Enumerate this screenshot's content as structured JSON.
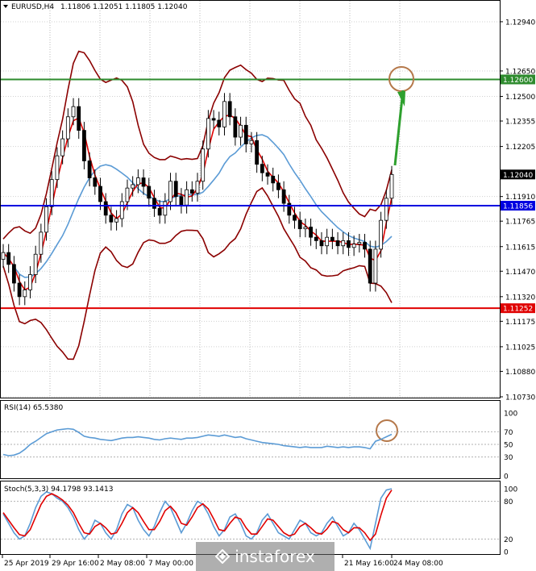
{
  "header": {
    "symbol": "EURUSD,H4",
    "ohlc": "1.11806 1.12051 1.11805 1.12040",
    "rsi_label": "RSI(14) 65.5380",
    "stoch_label": "Stoch(5,3,3) 94.1798 93.1413"
  },
  "levels": {
    "green": {
      "value": 1.126,
      "label": "1.12600",
      "color": "#2e8b2e"
    },
    "blue": {
      "value": 1.11856,
      "label": "1.11856",
      "color": "#0000e0"
    },
    "red": {
      "value": 1.11252,
      "label": "1.11252",
      "color": "#e00000"
    },
    "current": {
      "value": 1.1204,
      "label": "1.12040",
      "color": "#000000"
    }
  },
  "watermark": {
    "text": "instaforex"
  },
  "chart_data": [
    {
      "type": "candlestick",
      "title": "EURUSD,H4",
      "ylim": [
        1.1073,
        1.1303
      ],
      "y_ticks": [
        "1.12940",
        "1.12650",
        "1.12500",
        "1.12355",
        "1.12205",
        "1.11910",
        "1.11765",
        "1.11615",
        "1.11470",
        "1.11320",
        "1.11175",
        "1.11025",
        "1.10880",
        "1.10730"
      ],
      "x_ticks": [
        "25 Apr 2019",
        "29 Apr 16:00",
        "2 May 08:00",
        "7 May 00:00",
        "21 May 16:00",
        "24 May 08:00"
      ],
      "close": [
        1.1158,
        1.1151,
        1.114,
        1.1132,
        1.1136,
        1.1145,
        1.1157,
        1.117,
        1.1185,
        1.1201,
        1.1215,
        1.1225,
        1.1238,
        1.1244,
        1.123,
        1.1212,
        1.1202,
        1.1197,
        1.1188,
        1.118,
        1.1176,
        1.1178,
        1.1188,
        1.1196,
        1.1198,
        1.1202,
        1.1197,
        1.119,
        1.1184,
        1.118,
        1.1188,
        1.12,
        1.1191,
        1.1186,
        1.1195,
        1.1193,
        1.12,
        1.1219,
        1.1237,
        1.1236,
        1.1232,
        1.1247,
        1.1238,
        1.1226,
        1.1233,
        1.1222,
        1.1224,
        1.121,
        1.1205,
        1.1203,
        1.1199,
        1.1195,
        1.1187,
        1.118,
        1.1177,
        1.1172,
        1.1173,
        1.1167,
        1.1165,
        1.1162,
        1.1167,
        1.1165,
        1.1162,
        1.1165,
        1.1161,
        1.1163,
        1.1164,
        1.116,
        1.114,
        1.116,
        1.1177,
        1.119,
        1.1204
      ],
      "series": [
        {
          "name": "Bollinger upper",
          "color": "#8b0000"
        },
        {
          "name": "Bollinger lower",
          "color": "#8b0000"
        },
        {
          "name": "fast MA",
          "color": "#e00000"
        },
        {
          "name": "slow MA",
          "color": "#5b9bd5"
        }
      ]
    },
    {
      "type": "line",
      "title": "RSI(14) 65.5380",
      "ylim": [
        0,
        100
      ],
      "levels": [
        70,
        50,
        30
      ],
      "y_ticks": [
        "100",
        "70",
        "50",
        "30",
        "0"
      ],
      "series": [
        {
          "name": "RSI",
          "color": "#5b9bd5",
          "values": [
            34,
            32,
            33,
            36,
            42,
            50,
            55,
            61,
            67,
            70,
            73,
            74,
            75,
            74,
            69,
            63,
            61,
            60,
            58,
            57,
            56,
            58,
            60,
            61,
            61,
            62,
            61,
            60,
            58,
            57,
            59,
            60,
            59,
            58,
            60,
            60,
            61,
            63,
            65,
            64,
            63,
            65,
            63,
            61,
            62,
            59,
            57,
            55,
            53,
            52,
            51,
            50,
            48,
            47,
            46,
            45,
            46,
            45,
            45,
            45,
            47,
            46,
            45,
            46,
            45,
            46,
            46,
            45,
            43,
            55,
            58,
            62,
            66
          ]
        }
      ]
    },
    {
      "type": "line",
      "title": "Stoch(5,3,3) 94.1798 93.1413",
      "ylim": [
        0,
        100
      ],
      "levels": [
        80,
        20
      ],
      "y_ticks": [
        "100",
        "80",
        "20",
        "0"
      ],
      "series": [
        {
          "name": "%K",
          "color": "#5b9bd5",
          "values": [
            60,
            45,
            30,
            20,
            25,
            45,
            70,
            88,
            95,
            92,
            85,
            80,
            70,
            55,
            35,
            20,
            30,
            50,
            45,
            30,
            20,
            35,
            60,
            75,
            70,
            50,
            35,
            25,
            40,
            62,
            80,
            70,
            50,
            30,
            45,
            65,
            80,
            75,
            60,
            40,
            25,
            35,
            55,
            60,
            45,
            25,
            20,
            30,
            50,
            60,
            45,
            30,
            25,
            20,
            35,
            50,
            45,
            30,
            25,
            30,
            45,
            55,
            40,
            25,
            30,
            45,
            35,
            20,
            5,
            45,
            85,
            98,
            100
          ]
        },
        {
          "name": "%D",
          "color": "#e00000",
          "values": [
            62,
            50,
            38,
            27,
            25,
            35,
            55,
            75,
            88,
            92,
            88,
            82,
            74,
            62,
            45,
            30,
            28,
            40,
            45,
            38,
            28,
            30,
            45,
            62,
            70,
            62,
            48,
            35,
            35,
            48,
            65,
            72,
            62,
            45,
            42,
            55,
            70,
            76,
            68,
            52,
            35,
            33,
            45,
            55,
            52,
            38,
            28,
            28,
            40,
            52,
            50,
            40,
            30,
            25,
            28,
            40,
            45,
            38,
            30,
            28,
            36,
            48,
            45,
            35,
            30,
            38,
            38,
            30,
            18,
            28,
            58,
            85,
            98
          ]
        }
      ]
    }
  ]
}
